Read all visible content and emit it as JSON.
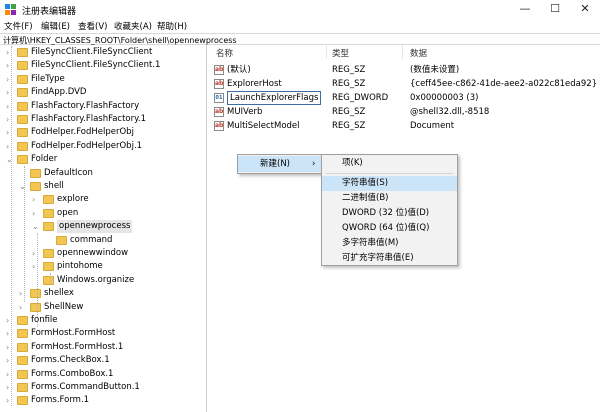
{
  "window": {
    "title": "注册表编辑器",
    "min_glyph": "—",
    "max_glyph": "☐",
    "close_glyph": "✕",
    "icon": "regedit-icon"
  },
  "menu": [
    "文件(F)",
    "编辑(E)",
    "查看(V)",
    "收藏夹(A)",
    "帮助(H)"
  ],
  "address": "计算机\\HKEY_CLASSES_ROOT\\Folder\\shell\\opennewprocess",
  "tree": [
    {
      "label": "FileSyncClient.FileSyncClient",
      "arrow": ">",
      "depth": 0
    },
    {
      "label": "FileSyncClient.FileSyncClient.1",
      "arrow": ">",
      "depth": 0
    },
    {
      "label": "FileType",
      "arrow": ">",
      "depth": 0
    },
    {
      "label": "FindApp.DVD",
      "arrow": ">",
      "depth": 0
    },
    {
      "label": "FlashFactory.FlashFactory",
      "arrow": ">",
      "depth": 0
    },
    {
      "label": "FlashFactory.FlashFactory.1",
      "arrow": ">",
      "depth": 0
    },
    {
      "label": "FodHelper.FodHelperObj",
      "arrow": ">",
      "depth": 0
    },
    {
      "label": "FodHelper.FodHelperObj.1",
      "arrow": ">",
      "depth": 0
    },
    {
      "label": "Folder",
      "arrow": "v",
      "depth": 0
    },
    {
      "label": "DefaultIcon",
      "arrow": "",
      "depth": 1
    },
    {
      "label": "shell",
      "arrow": "v",
      "depth": 1
    },
    {
      "label": "explore",
      "arrow": ">",
      "depth": 2
    },
    {
      "label": "open",
      "arrow": ">",
      "depth": 2
    },
    {
      "label": "opennewprocess",
      "arrow": "v",
      "depth": 2,
      "selected": true
    },
    {
      "label": "command",
      "arrow": "",
      "depth": 3
    },
    {
      "label": "opennewwindow",
      "arrow": ">",
      "depth": 2
    },
    {
      "label": "pintohome",
      "arrow": ">",
      "depth": 2
    },
    {
      "label": "Windows.organize",
      "arrow": "",
      "depth": 2
    },
    {
      "label": "shellex",
      "arrow": ">",
      "depth": 1
    },
    {
      "label": "ShellNew",
      "arrow": ">",
      "depth": 1
    },
    {
      "label": "fonfile",
      "arrow": ">",
      "depth": 0
    },
    {
      "label": "FormHost.FormHost",
      "arrow": ">",
      "depth": 0
    },
    {
      "label": "FormHost.FormHost.1",
      "arrow": ">",
      "depth": 0
    },
    {
      "label": "Forms.CheckBox.1",
      "arrow": ">",
      "depth": 0
    },
    {
      "label": "Forms.ComboBox.1",
      "arrow": ">",
      "depth": 0
    },
    {
      "label": "Forms.CommandButton.1",
      "arrow": ">",
      "depth": 0
    },
    {
      "label": "Forms.Form.1",
      "arrow": ">",
      "depth": 0
    }
  ],
  "columns": {
    "name": "名称",
    "type": "类型",
    "data": "数据"
  },
  "values": [
    {
      "name": "(默认)",
      "type": "REG_SZ",
      "data": "(数值未设置)",
      "icon": "ab"
    },
    {
      "name": "ExplorerHost",
      "type": "REG_SZ",
      "data": "{ceff45ee-c862-41de-aee2-a022c81eda92}",
      "icon": "ab"
    },
    {
      "name": "LaunchExplorerFlags",
      "type": "REG_DWORD",
      "data": "0x00000003 (3)",
      "icon": "bin",
      "editing": true
    },
    {
      "name": "MUIVerb",
      "type": "REG_SZ",
      "data": "@shell32.dll,-8518",
      "icon": "ab"
    },
    {
      "name": "MultiSelectModel",
      "type": "REG_SZ",
      "data": "Document",
      "icon": "ab"
    }
  ],
  "context_menu": {
    "new_label": "新建(N)",
    "submenu_arrow": "›",
    "submenu": [
      {
        "label": "项(K)"
      },
      {
        "label": "字符串值(S)",
        "highlighted": true
      },
      {
        "label": "二进制值(B)"
      },
      {
        "label": "DWORD (32 位)值(D)"
      },
      {
        "label": "QWORD (64 位)值(Q)"
      },
      {
        "label": "多字符串值(M)"
      },
      {
        "label": "可扩充字符串值(E)"
      }
    ]
  },
  "colors": {
    "folder": "#f2c650",
    "selection": "#cce4f7",
    "menu_bg": "#f2f2f2"
  }
}
